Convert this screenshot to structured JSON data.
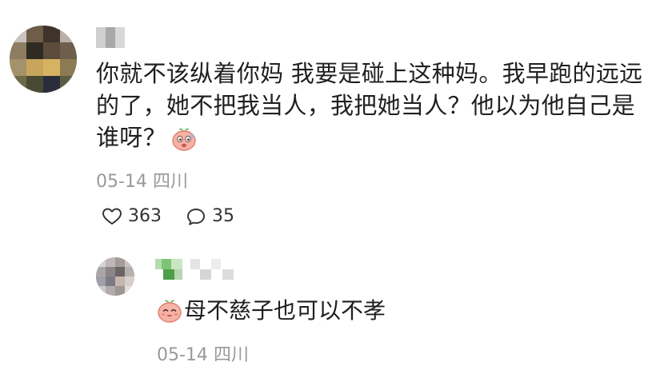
{
  "comment": {
    "username_blurred": true,
    "text": "你就不该纵着你妈 我要是碰上这种妈。我早跑的远远的了，她不把我当人，我把她当人？他以为他自己是谁呀？",
    "emoji": "sweat-smile-face-icon",
    "date": "05-14",
    "location": "四川",
    "likes": "363",
    "replies": "35"
  },
  "reply": {
    "username_blurred": true,
    "emoji": "smile-face-icon",
    "text": "母不慈子也可以不孝",
    "date": "05-14",
    "location": "四川"
  },
  "colors": {
    "text": "#1f1f1f",
    "meta": "#999999",
    "emoji_face": "#f6b2a6",
    "emoji_leaf": "#59b44a"
  }
}
